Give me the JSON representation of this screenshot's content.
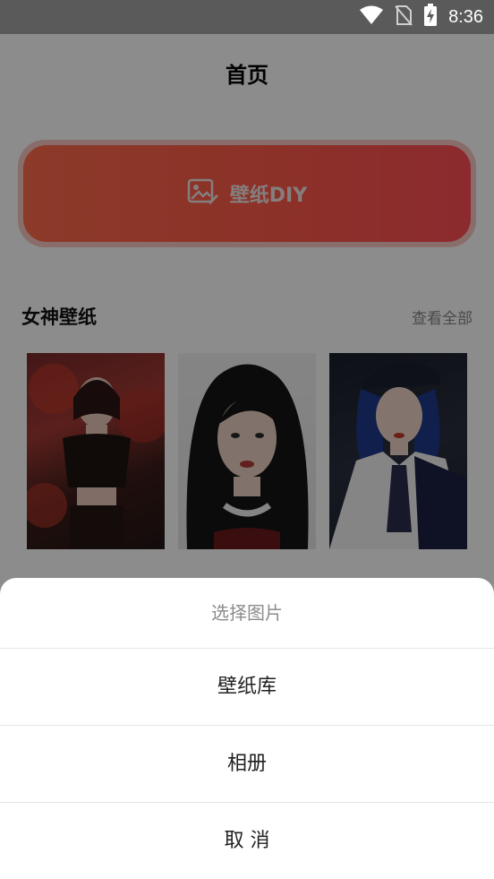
{
  "status_bar": {
    "time": "8:36",
    "icons": [
      "wifi-icon",
      "no-sim-icon",
      "battery-charging-icon"
    ]
  },
  "header": {
    "title": "首页"
  },
  "diy_button": {
    "label": "壁纸DIY",
    "icon": "image-edit-icon"
  },
  "section": {
    "title": "女神壁纸",
    "see_all": "查看全部"
  },
  "wallpapers": [
    {
      "name": "wallpaper-1"
    },
    {
      "name": "wallpaper-2"
    },
    {
      "name": "wallpaper-3"
    }
  ],
  "action_sheet": {
    "title": "选择图片",
    "options": [
      "壁纸库",
      "相册"
    ],
    "cancel": "取 消"
  },
  "colors": {
    "accent": "#ff5a49",
    "overlay": "rgba(0,0,0,0.45)"
  }
}
